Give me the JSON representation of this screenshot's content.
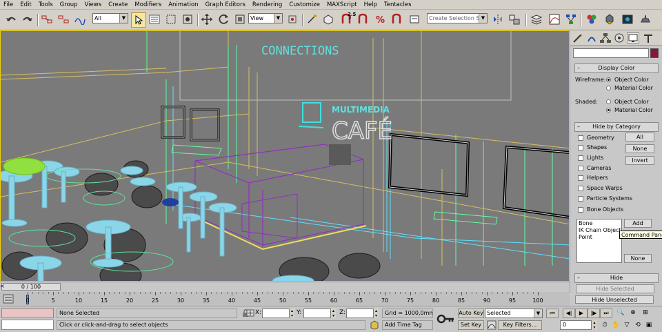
{
  "menu": [
    "File",
    "Edit",
    "Tools",
    "Group",
    "Views",
    "Create",
    "Modifiers",
    "Animation",
    "Graph Editors",
    "Rendering",
    "Customize",
    "MAXScript",
    "Help",
    "Tentacles"
  ],
  "toolbar": {
    "selection_filter": "All",
    "reference_coord": "View",
    "snap_angle_label": "2.5",
    "named_selection_placeholder": "Create Selection Set"
  },
  "viewport": {
    "signs": [
      "CONNECTIONS",
      "MULTIMEDIA",
      "CAFÉ"
    ]
  },
  "command_panel": {
    "display_color": {
      "title": "Display Color",
      "wireframe_label": "Wireframe:",
      "shaded_label": "Shaded:",
      "options": [
        "Object Color",
        "Material Color"
      ],
      "wireframe_selected": "Object Color",
      "shaded_selected": "Material Color"
    },
    "hide_by_category": {
      "title": "Hide by Category",
      "categories": [
        "Geometry",
        "Shapes",
        "Lights",
        "Cameras",
        "Helpers",
        "Space Warps",
        "Particle Systems",
        "Bone Objects"
      ],
      "buttons": [
        "All",
        "None",
        "Invert"
      ],
      "list_items": [
        "Bone",
        "IK Chain Object",
        "Point"
      ],
      "add_label": "Add",
      "none_label": "None"
    },
    "hide": {
      "title": "Hide",
      "hide_selected": "Hide Selected",
      "hide_unselected": "Hide Unselected"
    },
    "tooltip": "Command Panel"
  },
  "timeline": {
    "slider_label": "0 / 100",
    "ticks": [
      "0",
      "5",
      "10",
      "15",
      "20",
      "25",
      "30",
      "35",
      "40",
      "45",
      "50",
      "55",
      "60",
      "65",
      "70",
      "75",
      "80",
      "85",
      "90",
      "95",
      "100"
    ]
  },
  "status": {
    "selection": "None Selected",
    "prompt": "Click or click-and-drag to select objects",
    "x_label": "X:",
    "y_label": "Y:",
    "z_label": "Z:",
    "grid": "Grid = 1000,0mm",
    "add_time_tag": "Add Time Tag",
    "auto_key": "Auto Key",
    "set_key": "Set Key",
    "key_mode": "Selected",
    "key_filters": "Key Filters...",
    "frame": "0"
  },
  "colors": {
    "viewport_bg": "#7a7a7a",
    "object_swatch": "#8c1438",
    "active_border": "#f0d000"
  }
}
